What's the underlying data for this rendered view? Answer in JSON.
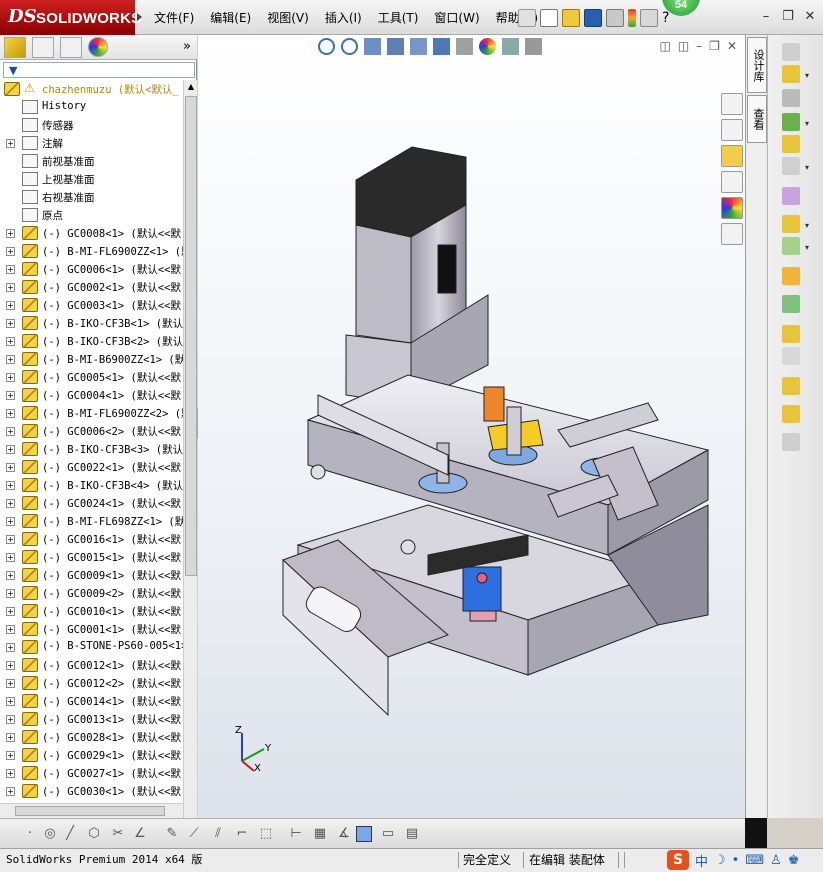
{
  "app": {
    "brand_ds": "DS",
    "brand_name": "SOLIDWORKS",
    "badge": "54"
  },
  "menu": [
    {
      "id": "file",
      "label": "文件(F)"
    },
    {
      "id": "edit",
      "label": "编辑(E)"
    },
    {
      "id": "view",
      "label": "视图(V)"
    },
    {
      "id": "insert",
      "label": "插入(I)"
    },
    {
      "id": "tools",
      "label": "工具(T)"
    },
    {
      "id": "window",
      "label": "窗口(W)"
    },
    {
      "id": "help",
      "label": "帮助(H)"
    }
  ],
  "tree": {
    "root_label": "chazhenmuzu  (默认<默认_",
    "items": [
      {
        "label": "History",
        "icon": "history-icon",
        "expand": false
      },
      {
        "label": "传感器",
        "icon": "sensor-icon",
        "expand": false
      },
      {
        "label": "注解",
        "icon": "annotation-icon",
        "expand": true
      },
      {
        "label": "前视基准面",
        "icon": "plane-icon",
        "expand": false
      },
      {
        "label": "上视基准面",
        "icon": "plane-icon",
        "expand": false
      },
      {
        "label": "右视基准面",
        "icon": "plane-icon",
        "expand": false
      },
      {
        "label": "原点",
        "icon": "origin-icon",
        "expand": false
      },
      {
        "label": "(-) GC0008<1> (默认<<默",
        "icon": "part-icon",
        "expand": true
      },
      {
        "label": "(-) B-MI-FL6900ZZ<1> (默",
        "icon": "part-icon",
        "expand": true
      },
      {
        "label": "(-) GC0006<1> (默认<<默",
        "icon": "part-icon",
        "expand": true
      },
      {
        "label": "(-) GC0002<1> (默认<<默",
        "icon": "part-icon",
        "expand": true
      },
      {
        "label": "(-) GC0003<1> (默认<<默",
        "icon": "part-icon",
        "expand": true
      },
      {
        "label": "(-) B-IKO-CF3B<1> (默认",
        "icon": "part-icon",
        "expand": true
      },
      {
        "label": "(-) B-IKO-CF3B<2> (默认",
        "icon": "part-icon",
        "expand": true
      },
      {
        "label": "(-) B-MI-B6900ZZ<1> (默",
        "icon": "part-icon",
        "expand": true
      },
      {
        "label": "(-) GC0005<1> (默认<<默",
        "icon": "part-icon",
        "expand": true
      },
      {
        "label": "(-) GC0004<1> (默认<<默",
        "icon": "part-icon",
        "expand": true
      },
      {
        "label": "(-) B-MI-FL6900ZZ<2> (默",
        "icon": "part-icon",
        "expand": true
      },
      {
        "label": "(-) GC0006<2> (默认<<默",
        "icon": "part-icon",
        "expand": true
      },
      {
        "label": "(-) B-IKO-CF3B<3> (默认",
        "icon": "part-icon",
        "expand": true
      },
      {
        "label": "(-) GC0022<1> (默认<<默",
        "icon": "part-icon",
        "expand": true
      },
      {
        "label": "(-) B-IKO-CF3B<4> (默认",
        "icon": "part-icon",
        "expand": true
      },
      {
        "label": "(-) GC0024<1> (默认<<默",
        "icon": "part-icon",
        "expand": true
      },
      {
        "label": "(-) B-MI-FL698ZZ<1> (默",
        "icon": "part-icon",
        "expand": true
      },
      {
        "label": "(-) GC0016<1> (默认<<默",
        "icon": "part-icon",
        "expand": true
      },
      {
        "label": "(-) GC0015<1> (默认<<默",
        "icon": "part-icon",
        "expand": true
      },
      {
        "label": "(-) GC0009<1> (默认<<默",
        "icon": "part-icon",
        "expand": true
      },
      {
        "label": "(-) GC0009<2> (默认<<默",
        "icon": "part-icon",
        "expand": true
      },
      {
        "label": "(-) GC0010<1> (默认<<默",
        "icon": "part-icon",
        "expand": true
      },
      {
        "label": "(-) GC0001<1> (默认<<默",
        "icon": "part-icon",
        "expand": true
      },
      {
        "label": "(-) B-STONE-PS60-005<1>",
        "icon": "part-icon",
        "expand": true
      },
      {
        "label": "(-) GC0012<1> (默认<<默",
        "icon": "part-icon",
        "expand": true
      },
      {
        "label": "(-) GC0012<2> (默认<<默",
        "icon": "part-icon",
        "expand": true
      },
      {
        "label": "(-) GC0014<1> (默认<<默",
        "icon": "part-icon",
        "expand": true
      },
      {
        "label": "(-) GC0013<1> (默认<<默",
        "icon": "part-icon",
        "expand": true
      },
      {
        "label": "(-) GC0028<1> (默认<<默",
        "icon": "part-icon",
        "expand": true
      },
      {
        "label": "(-) GC0029<1> (默认<<默",
        "icon": "part-icon",
        "expand": true
      },
      {
        "label": "(-) GC0027<1> (默认<<默",
        "icon": "part-icon",
        "expand": true
      },
      {
        "label": "(-) GC0030<1> (默认<<默",
        "icon": "part-icon",
        "expand": true
      }
    ]
  },
  "triad": {
    "x": "X",
    "y": "Y",
    "z": "Z"
  },
  "right_tabs": {
    "tab1": "设计库",
    "tab2": "查看"
  },
  "status": {
    "product": "SolidWorks Premium 2014 x64 版",
    "fully_defined": "完全定义",
    "editing": "在编辑 装配体"
  },
  "ime": {
    "s": "S",
    "zh": "中"
  },
  "colors": {
    "accent": "#c00000",
    "part_yellow": "#f3d24a",
    "viewport_top": "#ffffff"
  }
}
